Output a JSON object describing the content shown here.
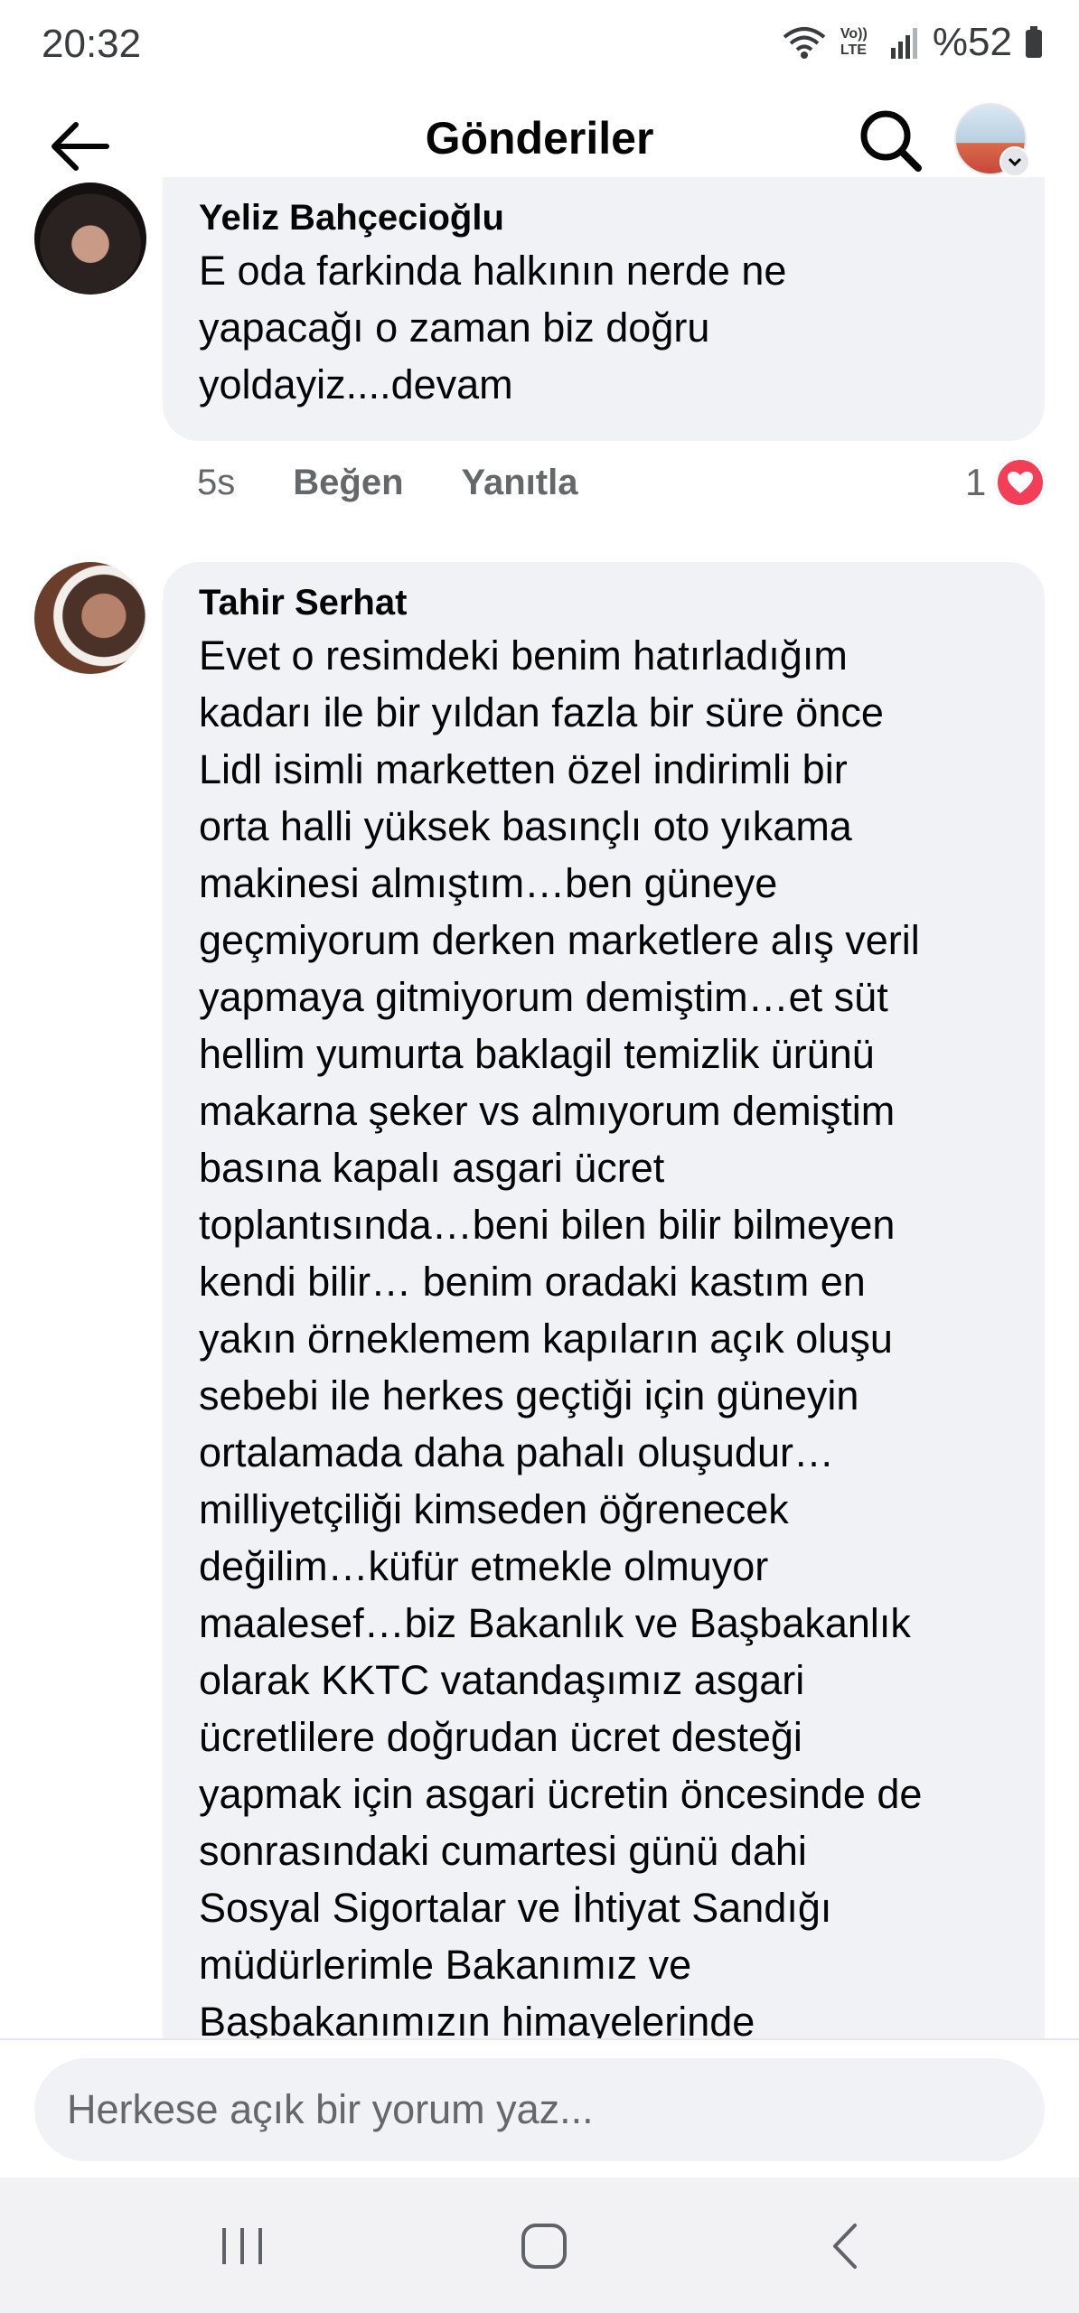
{
  "status_bar": {
    "time": "20:32",
    "volte": "Vo)) LTE",
    "battery": "%52"
  },
  "app_bar": {
    "title": "Gönderiler",
    "icons": [
      "back-arrow-icon",
      "search-icon",
      "profile-avatar",
      "chevron-down-icon"
    ]
  },
  "comments": [
    {
      "author": "Yeliz Bahçecioğlu",
      "text": "E oda farkinda halkının nerde ne\nyapacağı o zaman biz doğru\nyoldayiz....devam",
      "time": "5s",
      "like_label": "Beğen",
      "reply_label": "Yanıtla",
      "reaction_count": "1",
      "reaction_icon": "heart-icon"
    },
    {
      "author": "Tahir Serhat",
      "text": "Evet o resimdeki benim hatırladığım\nkadarı ile bir yıldan fazla bir süre önce\nLidl isimli marketten özel indirimli bir\norta halli yüksek basınçlı oto yıkama\nmakinesi almıştım…ben güneye\ngeçmiyorum derken marketlere alış veril\nyapmaya gitmiyorum demiştim…et süt\nhellim yumurta baklagil temizlik ürünü\nmakarna şeker vs almıyorum demiştim\nbasına kapalı asgari ücret\ntoplantısında…beni bilen bilir bilmeyen\nkendi bilir… benim oradaki kastım en\nyakın örneklemem kapıların açık oluşu\nsebebi ile herkes geçtiği için güneyin\nortalamada daha pahalı oluşudur…\nmilliyetçiliği kimseden öğrenecek\ndeğilim…küfür etmekle olmuyor\nmaalesef…biz Bakanlık ve Başbakanlık\nolarak KKTC vatandaşımız asgari\nücretlilere doğrudan ücret desteği\nyapmak için asgari ücretin öncesinde de\nsonrasındaki cumartesi günü dahi\nSosyal Sigortalar ve İhtiyat Sandığı\nmüdürlerimle Bakanımız ve\nBaşbakanımızın himayelerinde"
    }
  ],
  "composer": {
    "placeholder": "Herkese açık bir yorum yaz..."
  },
  "nav_bar": {
    "icons": [
      "recent-apps-icon",
      "home-icon",
      "back-icon"
    ]
  },
  "colors": {
    "bubble": "#f0f2f5",
    "secondary_text": "#65676b",
    "heart": "#f33e58"
  }
}
